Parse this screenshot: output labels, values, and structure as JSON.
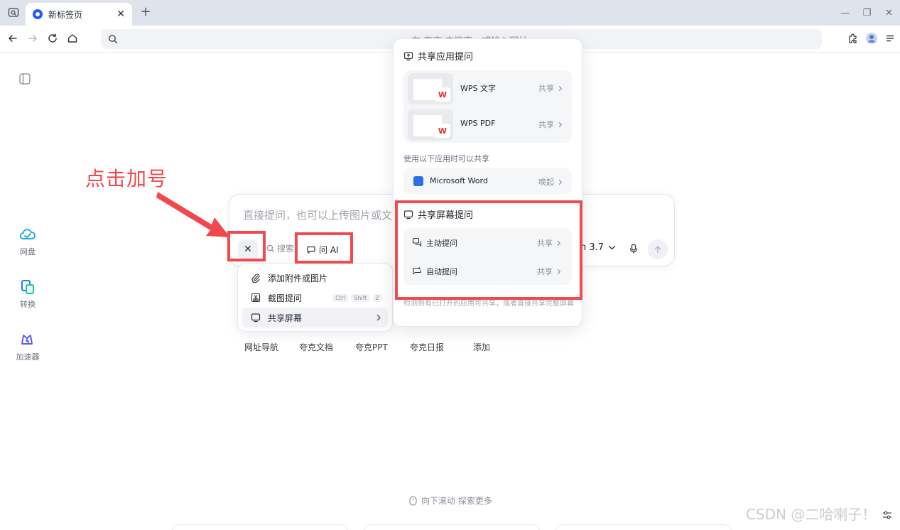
{
  "tabbar": {
    "tab_title": "新标签页",
    "tab_close": "✕",
    "new_tab": "+",
    "minimize": "—",
    "restore": "❐",
    "close": "✕"
  },
  "addressbar": {
    "placeholder": "在 夸克 中搜索，或输入网址"
  },
  "rail": {
    "items": [
      {
        "label": "网盘",
        "icon": "cloud-drive-icon"
      },
      {
        "label": "转换",
        "icon": "convert-icon"
      },
      {
        "label": "加速器",
        "icon": "accelerator-icon"
      }
    ]
  },
  "annotation": {
    "text": "点击加号"
  },
  "input": {
    "placeholder": "直接提问，也可以上传图片或文件",
    "close_glyph": "✕",
    "search_label": "搜索",
    "ask_ai_label": "问 AI",
    "model_label": "n 3.7"
  },
  "attach_menu": {
    "items": [
      {
        "label": "添加附件或图片"
      },
      {
        "label": "截图提问",
        "keys": [
          "Ctrl",
          "Shift",
          "Z"
        ]
      },
      {
        "label": "共享屏幕"
      }
    ]
  },
  "shortcuts": [
    "网址导航",
    "夸克文档",
    "夸克PPT",
    "夸克日报",
    "添加"
  ],
  "share_panel": {
    "header": "共享应用提问",
    "apps": [
      {
        "name": "WPS 文字",
        "action": "共享"
      },
      {
        "name": "WPS PDF",
        "action": "共享"
      }
    ],
    "wps_glyph": "W",
    "subhead": "使用以下应用时可以共享",
    "word": {
      "name": "Microsoft Word",
      "action": "唤起"
    },
    "screen_header": "共享屏幕提问",
    "screen_items": [
      {
        "name": "主动提问",
        "action": "共享"
      },
      {
        "name": "自动提问",
        "action": "共享"
      }
    ],
    "note": "检测到有已打开的应用可共享，或者直接共享完整屏幕"
  },
  "footer": {
    "scroll_hint": "向下滚动 探索更多",
    "watermark": "CSDN @二哈喇子！"
  },
  "colors": {
    "accent_red": "#f04a4e",
    "brand_blue": "#1d5cf5"
  }
}
